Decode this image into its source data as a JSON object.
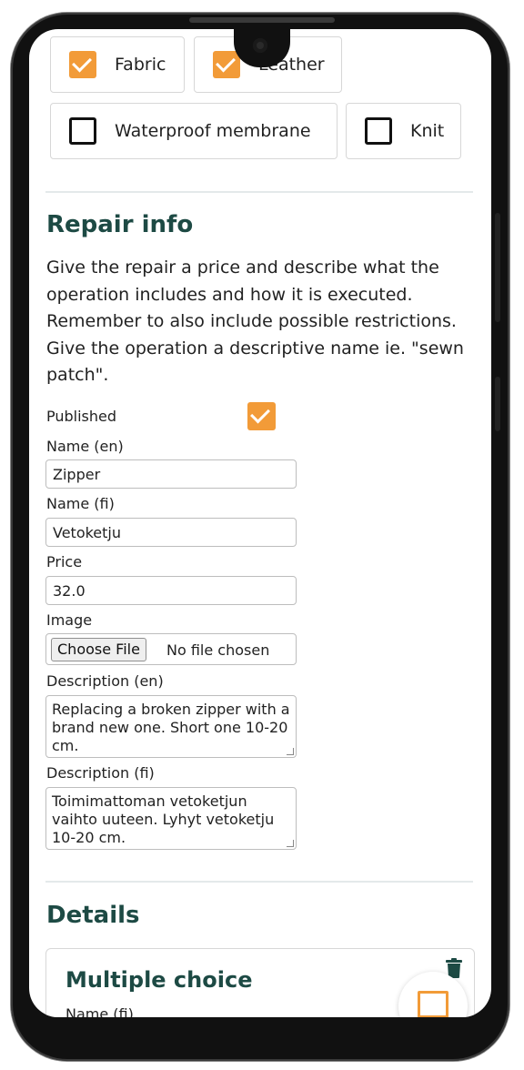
{
  "materials": [
    {
      "label": "Fabric",
      "checked": true
    },
    {
      "label": "Leather",
      "checked": true
    },
    {
      "label": "Waterproof membrane",
      "checked": false
    },
    {
      "label": "Knit",
      "checked": false
    }
  ],
  "repair_info": {
    "heading": "Repair info",
    "intro": "Give the repair a price and describe what the operation includes and how it is executed. Remember to also include possible restrictions. Give the operation a descriptive name ie. \"sewn patch\"."
  },
  "form": {
    "published_label": "Published",
    "published_checked": true,
    "name_en_label": "Name (en)",
    "name_en_value": "Zipper",
    "name_fi_label": "Name (fi)",
    "name_fi_value": "Vetoketju",
    "price_label": "Price",
    "price_value": "32.0",
    "image_label": "Image",
    "file_button": "Choose File",
    "file_status": "No file chosen",
    "desc_en_label": "Description (en)",
    "desc_en_value": "Replacing a broken zipper with a brand new one. Short one 10-20 cm.",
    "desc_fi_label": "Description (fi)",
    "desc_fi_value": "Toimimattoman vetoketjun vaihto uuteen. Lyhyt vetoketju 10-20 cm."
  },
  "details": {
    "heading": "Details",
    "card_title": "Multiple choice",
    "card_field_label": "Name (fi)"
  },
  "colors": {
    "accent": "#f29b38",
    "heading": "#1d4a44"
  },
  "icons": {
    "delete": "trash-icon",
    "fab": "chat-icon"
  }
}
